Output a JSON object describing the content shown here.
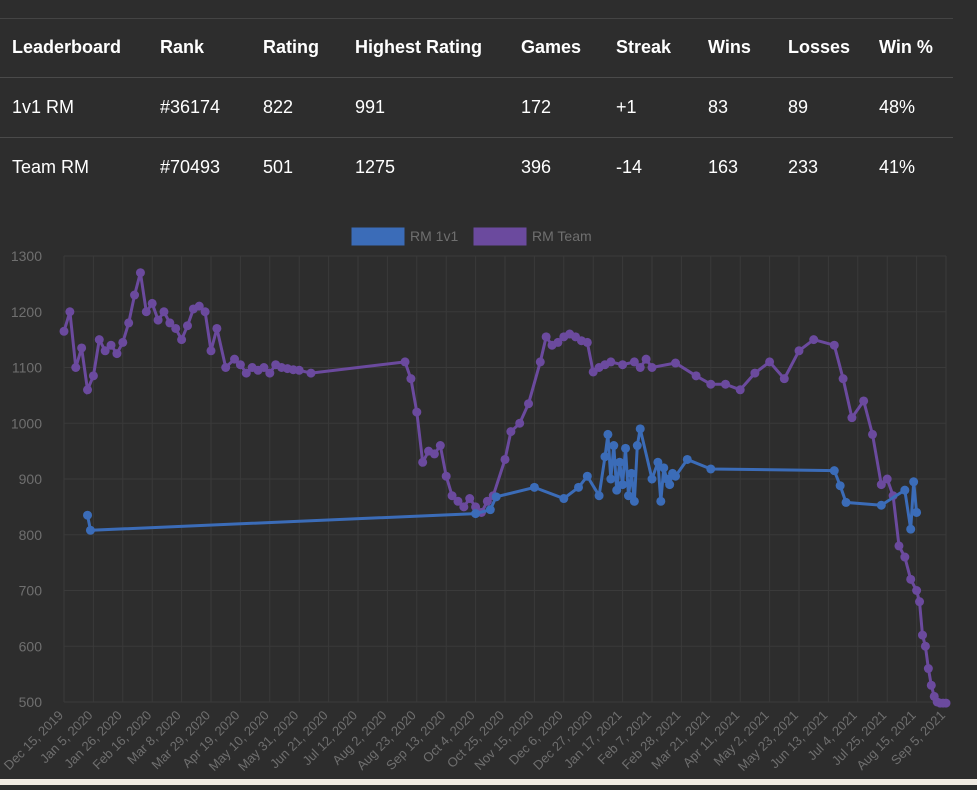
{
  "table": {
    "headers": [
      "Leaderboard",
      "Rank",
      "Rating",
      "Highest Rating",
      "Games",
      "Streak",
      "Wins",
      "Losses",
      "Win %"
    ],
    "rows": [
      [
        "1v1 RM",
        "#36174",
        "822",
        "991",
        "172",
        "+1",
        "83",
        "89",
        "48%"
      ],
      [
        "Team RM",
        "#70493",
        "501",
        "1275",
        "396",
        "-14",
        "163",
        "233",
        "41%"
      ]
    ]
  },
  "colors": {
    "rm1v1": "#3b6cb8",
    "rmteam": "#6b4a9e",
    "grid": "#3a3a3a",
    "tick": "#6f6f6f"
  },
  "chart_data": {
    "type": "line",
    "ylim": [
      500,
      1300
    ],
    "yticks": [
      "1300",
      "1200",
      "1100",
      "1000",
      "900",
      "800",
      "700",
      "600",
      "500"
    ],
    "xticks": [
      "Dec 15, 2019",
      "Jan 5, 2020",
      "Jan 26, 2020",
      "Feb 16, 2020",
      "Mar 8, 2020",
      "Mar 29, 2020",
      "Apr 19, 2020",
      "May 10, 2020",
      "May 31, 2020",
      "Jun 21, 2020",
      "Jul 12, 2020",
      "Aug 2, 2020",
      "Aug 23, 2020",
      "Sep 13, 2020",
      "Oct 4, 2020",
      "Oct 25, 2020",
      "Nov 15, 2020",
      "Dec 6, 2020",
      "Dec 27, 2020",
      "Jan 17, 2021",
      "Feb 7, 2021",
      "Feb 28, 2021",
      "Mar 21, 2021",
      "Apr 11, 2021",
      "May 2, 2021",
      "May 23, 2021",
      "Jun 13, 2021",
      "Jul 4, 2021",
      "Jul 25, 2021",
      "Aug 15, 2021",
      "Sep 5, 2021"
    ],
    "legend": [
      "RM 1v1",
      "RM Team"
    ],
    "legend_placement": "top",
    "series": [
      {
        "name": "RM 1v1",
        "x": [
          8,
          9,
          140,
          145,
          147,
          160,
          170,
          175,
          178,
          182,
          184,
          185,
          186,
          187,
          188,
          189,
          190,
          191,
          192,
          193,
          194,
          195,
          196,
          200,
          202,
          203,
          204,
          205,
          206,
          207,
          208,
          212,
          220,
          262,
          264,
          266,
          278,
          286,
          288,
          289,
          290
        ],
        "y": [
          835,
          808,
          838,
          845,
          868,
          885,
          865,
          885,
          905,
          870,
          940,
          980,
          900,
          960,
          880,
          930,
          890,
          955,
          870,
          910,
          860,
          960,
          990,
          900,
          930,
          860,
          920,
          900,
          890,
          910,
          905,
          935,
          918,
          915,
          888,
          858,
          853,
          880,
          810,
          895,
          840
        ]
      },
      {
        "name": "RM Team",
        "x": [
          0,
          2,
          4,
          6,
          8,
          10,
          12,
          14,
          16,
          18,
          20,
          22,
          24,
          26,
          28,
          30,
          32,
          34,
          36,
          38,
          40,
          42,
          44,
          46,
          48,
          50,
          52,
          55,
          58,
          60,
          62,
          64,
          66,
          68,
          70,
          72,
          74,
          76,
          78,
          80,
          84,
          116,
          118,
          120,
          122,
          124,
          126,
          128,
          130,
          132,
          134,
          136,
          138,
          140,
          142,
          144,
          146,
          150,
          152,
          155,
          158,
          162,
          164,
          166,
          168,
          170,
          172,
          174,
          176,
          178,
          180,
          182,
          184,
          186,
          190,
          194,
          196,
          198,
          200,
          208,
          215,
          220,
          225,
          230,
          235,
          240,
          245,
          250,
          255,
          262,
          265,
          268,
          272,
          275,
          278,
          280,
          282,
          284,
          286,
          288,
          290,
          291,
          292,
          293,
          294,
          295,
          296,
          297,
          298,
          299,
          300
        ],
        "y": [
          1165,
          1200,
          1100,
          1135,
          1060,
          1085,
          1150,
          1130,
          1140,
          1125,
          1145,
          1180,
          1230,
          1270,
          1200,
          1215,
          1185,
          1200,
          1180,
          1170,
          1150,
          1175,
          1205,
          1210,
          1200,
          1130,
          1170,
          1100,
          1115,
          1105,
          1090,
          1100,
          1095,
          1100,
          1090,
          1105,
          1100,
          1098,
          1096,
          1095,
          1090,
          1110,
          1080,
          1020,
          930,
          950,
          945,
          960,
          905,
          870,
          860,
          850,
          865,
          850,
          840,
          860,
          870,
          935,
          985,
          1000,
          1035,
          1110,
          1155,
          1140,
          1145,
          1155,
          1160,
          1155,
          1148,
          1145,
          1092,
          1100,
          1105,
          1110,
          1105,
          1110,
          1100,
          1115,
          1100,
          1108,
          1085,
          1070,
          1070,
          1060,
          1090,
          1110,
          1080,
          1130,
          1150,
          1140,
          1080,
          1010,
          1040,
          980,
          890,
          900,
          870,
          780,
          760,
          720,
          700,
          680,
          620,
          600,
          560,
          530,
          510,
          500,
          498,
          498,
          498
        ]
      }
    ]
  }
}
